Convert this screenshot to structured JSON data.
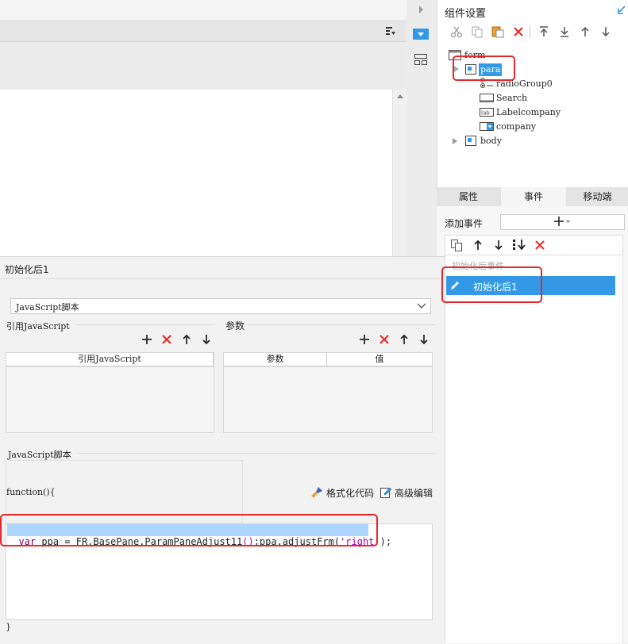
{
  "colors": {
    "accent": "#3399e6",
    "highlight": "#e5282a",
    "selection": "#add6ff",
    "selected_row": "#3399e6",
    "delete_red": "#e5282a"
  },
  "right_panel": {
    "title": "组件设置",
    "toolbar_icons": [
      "cut-icon",
      "copy-icon",
      "paste-icon",
      "delete-icon",
      "move-top-icon",
      "move-bottom-icon",
      "move-up-icon",
      "move-down-icon"
    ],
    "tree": [
      {
        "label": "form",
        "icon": "form-icon",
        "level": 0
      },
      {
        "label": "para",
        "icon": "para-icon",
        "level": 1,
        "selected": true
      },
      {
        "label": "radioGroup0",
        "icon": "radio-group-icon",
        "level": 2
      },
      {
        "label": "Search",
        "icon": "button-icon",
        "level": 2
      },
      {
        "label": "Labelcompany",
        "icon": "label-icon",
        "level": 2
      },
      {
        "label": "company",
        "icon": "combo-icon",
        "level": 2
      },
      {
        "label": "body",
        "icon": "body-icon",
        "level": 1
      }
    ],
    "tabs": [
      {
        "label": "属性",
        "active": false
      },
      {
        "label": "事件",
        "active": true
      },
      {
        "label": "移动端",
        "active": false
      }
    ],
    "add_event_label": "添加事件",
    "event_group": "初始化后事件",
    "event_item": "初始化后1"
  },
  "editor": {
    "title": "初始化后1",
    "type_select": "JavaScript脚本",
    "ref_js_label": "引用JavaScript",
    "params_label": "参数",
    "ref_js_col": "引用JavaScript",
    "param_col": "参数",
    "value_col": "值",
    "script_label": "JavaScript脚本",
    "fn_open": "function(){",
    "format_code": "格式化代码",
    "advanced_edit": "高级编辑",
    "code": {
      "kw": "var",
      "text1": " ppa = FR.BasePane.ParamPaneAdjust11",
      "parens": "()",
      "text2": ";ppa.adjustFrm(",
      "str": "'right'",
      "text3": ");"
    },
    "fn_close": "}"
  }
}
